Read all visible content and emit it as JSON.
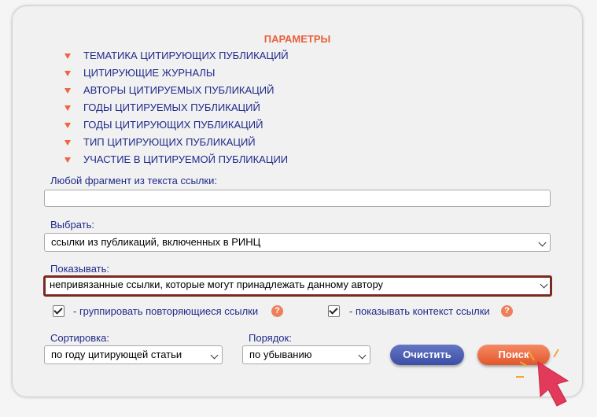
{
  "title": "ПАРАМЕТРЫ",
  "menu": [
    {
      "label": "ТЕМАТИКА ЦИТИРУЮЩИХ ПУБЛИКАЦИЙ"
    },
    {
      "label": "ЦИТИРУЮЩИЕ ЖУРНАЛЫ"
    },
    {
      "label": "АВТОРЫ ЦИТИРУЕМЫХ ПУБЛИКАЦИЙ"
    },
    {
      "label": "ГОДЫ ЦИТИРУЕМЫХ ПУБЛИКАЦИЙ"
    },
    {
      "label": "ГОДЫ ЦИТИРУЮЩИХ ПУБЛИКАЦИЙ"
    },
    {
      "label": "ТИП ЦИТИРУЮЩИХ ПУБЛИКАЦИЙ"
    },
    {
      "label": "УЧАСТИЕ В ЦИТИРУЕМОЙ ПУБЛИКАЦИИ"
    }
  ],
  "fragment": {
    "label": "Любой фрагмент из текста ссылки:",
    "value": ""
  },
  "choose": {
    "label": "Выбрать:",
    "value": "ссылки из публикаций, включенных в РИНЦ"
  },
  "show": {
    "label": "Показывать:",
    "value": "непривязанные ссылки, которые могут принадлежать данному автору"
  },
  "group_check": {
    "label": "- группировать повторяющиеся ссылки",
    "checked": true
  },
  "context_check": {
    "label": "- показывать контекст ссылки",
    "checked": true
  },
  "help_symbol": "?",
  "sort": {
    "label": "Сортировка:",
    "value": "по году цитирующей статьи"
  },
  "order": {
    "label": "Порядок:",
    "value": "по убыванию"
  },
  "buttons": {
    "clear": "Очистить",
    "search": "Поиск"
  },
  "colors": {
    "accent": "#e9603a",
    "link": "#1f2a8a",
    "clear_button": "#4a5bb0",
    "search_button": "#ee6a42",
    "cursor": "#e23a5a"
  }
}
